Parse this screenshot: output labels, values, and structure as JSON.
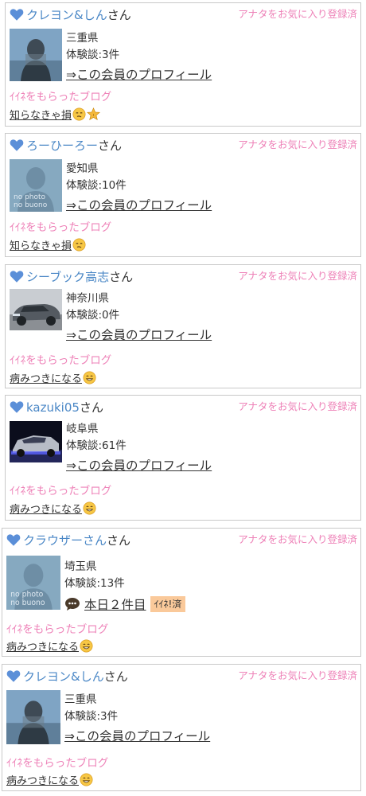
{
  "common": {
    "honorific": "さん",
    "fav_label": "アナタをお気に入り登録済",
    "profile_link": "⇒この会員のプロフィール",
    "blog_label": "ｲｲﾈをもらったブログ",
    "nophoto_line1": "no photo",
    "nophoto_line2": "no buono"
  },
  "members": [
    {
      "name": "クレヨン&しん",
      "pref": "三重県",
      "exp": "体験談:3件",
      "blog_title": "知らなきゃ損",
      "emojis": [
        "face-icon",
        "star-icon"
      ]
    },
    {
      "name": "ろーひーろー",
      "pref": "愛知県",
      "exp": "体験談:10件",
      "blog_title": "知らなきゃ損",
      "emojis": [
        "face-icon"
      ]
    },
    {
      "name": "シーブック高志",
      "pref": "神奈川県",
      "exp": "体験談:0件",
      "blog_title": "病みつきになる",
      "emojis": [
        "grin-icon"
      ]
    },
    {
      "name": "kazuki05",
      "pref": "岐阜県",
      "exp": "体験談:61件",
      "blog_title": "病みつきになる",
      "emojis": [
        "grin-icon"
      ]
    },
    {
      "name": "クラウザーさん",
      "pref": "埼玉県",
      "exp": "体験談:13件",
      "today_text": "本日２件目",
      "iine_badge": "ｲｲﾈ!済",
      "blog_title": "病みつきになる",
      "emojis": [
        "grin-icon"
      ]
    },
    {
      "name": "クレヨン&しん",
      "pref": "三重県",
      "exp": "体験談:3件",
      "blog_title": "病みつきになる",
      "emojis": [
        "grin-icon"
      ]
    }
  ],
  "colors": {
    "name_blue": "#4a87c6",
    "pink": "#ee82b8",
    "heart_blue": "#5b8fd8",
    "badge_bg": "#fac99a"
  }
}
